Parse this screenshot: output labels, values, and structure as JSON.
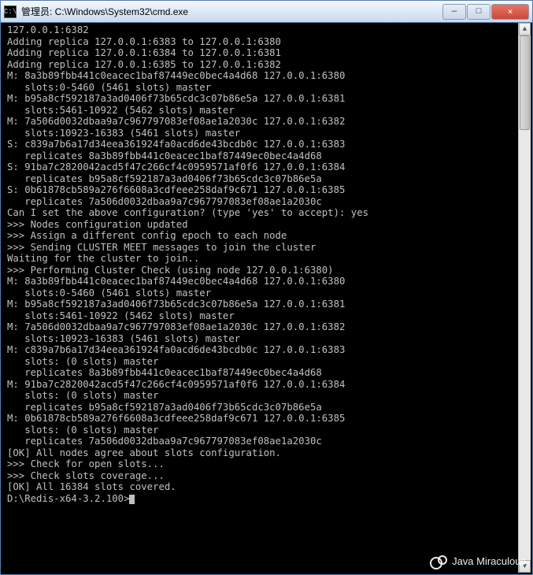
{
  "titlebar": {
    "icon_label": "C:\\",
    "title": "管理员: C:\\Windows\\System32\\cmd.exe"
  },
  "window_controls": {
    "minimize": "—",
    "maximize": "□",
    "close": "✕"
  },
  "scrollbar": {
    "up": "▲",
    "down": "▼"
  },
  "terminal": {
    "lines": [
      "127.0.0.1:6382",
      "Adding replica 127.0.0.1:6383 to 127.0.0.1:6380",
      "Adding replica 127.0.0.1:6384 to 127.0.0.1:6381",
      "Adding replica 127.0.0.1:6385 to 127.0.0.1:6382",
      "M: 8a3b89fbb441c0eacec1baf87449ec0bec4a4d68 127.0.0.1:6380",
      "   slots:0-5460 (5461 slots) master",
      "M: b95a8cf592187a3ad0406f73b65cdc3c07b86e5a 127.0.0.1:6381",
      "   slots:5461-10922 (5462 slots) master",
      "M: 7a506d0032dbaa9a7c967797083ef08ae1a2030c 127.0.0.1:6382",
      "   slots:10923-16383 (5461 slots) master",
      "S: c839a7b6a17d34eea361924fa0acd6de43bcdb0c 127.0.0.1:6383",
      "   replicates 8a3b89fbb441c0eacec1baf87449ec0bec4a4d68",
      "S: 91ba7c2820042acd5f47c266cf4c0959571af0f6 127.0.0.1:6384",
      "   replicates b95a8cf592187a3ad0406f73b65cdc3c07b86e5a",
      "S: 0b61878cb589a276f6608a3cdfeee258daf9c671 127.0.0.1:6385",
      "   replicates 7a506d0032dbaa9a7c967797083ef08ae1a2030c",
      "Can I set the above configuration? (type 'yes' to accept): yes",
      ">>> Nodes configuration updated",
      ">>> Assign a different config epoch to each node",
      ">>> Sending CLUSTER MEET messages to join the cluster",
      "Waiting for the cluster to join..",
      ">>> Performing Cluster Check (using node 127.0.0.1:6380)",
      "M: 8a3b89fbb441c0eacec1baf87449ec0bec4a4d68 127.0.0.1:6380",
      "   slots:0-5460 (5461 slots) master",
      "M: b95a8cf592187a3ad0406f73b65cdc3c07b86e5a 127.0.0.1:6381",
      "   slots:5461-10922 (5462 slots) master",
      "M: 7a506d0032dbaa9a7c967797083ef08ae1a2030c 127.0.0.1:6382",
      "   slots:10923-16383 (5461 slots) master",
      "M: c839a7b6a17d34eea361924fa0acd6de43bcdb0c 127.0.0.1:6383",
      "   slots: (0 slots) master",
      "   replicates 8a3b89fbb441c0eacec1baf87449ec0bec4a4d68",
      "M: 91ba7c2820042acd5f47c266cf4c0959571af0f6 127.0.0.1:6384",
      "   slots: (0 slots) master",
      "   replicates b95a8cf592187a3ad0406f73b65cdc3c07b86e5a",
      "M: 0b61878cb589a276f6608a3cdfeee258daf9c671 127.0.0.1:6385",
      "   slots: (0 slots) master",
      "   replicates 7a506d0032dbaa9a7c967797083ef08ae1a2030c",
      "[OK] All nodes agree about slots configuration.",
      ">>> Check for open slots...",
      ">>> Check slots coverage...",
      "[OK] All 16384 slots covered.",
      "",
      "D:\\Redis-x64-3.2.100>"
    ]
  },
  "watermark": {
    "text": "Java Miraculous"
  }
}
